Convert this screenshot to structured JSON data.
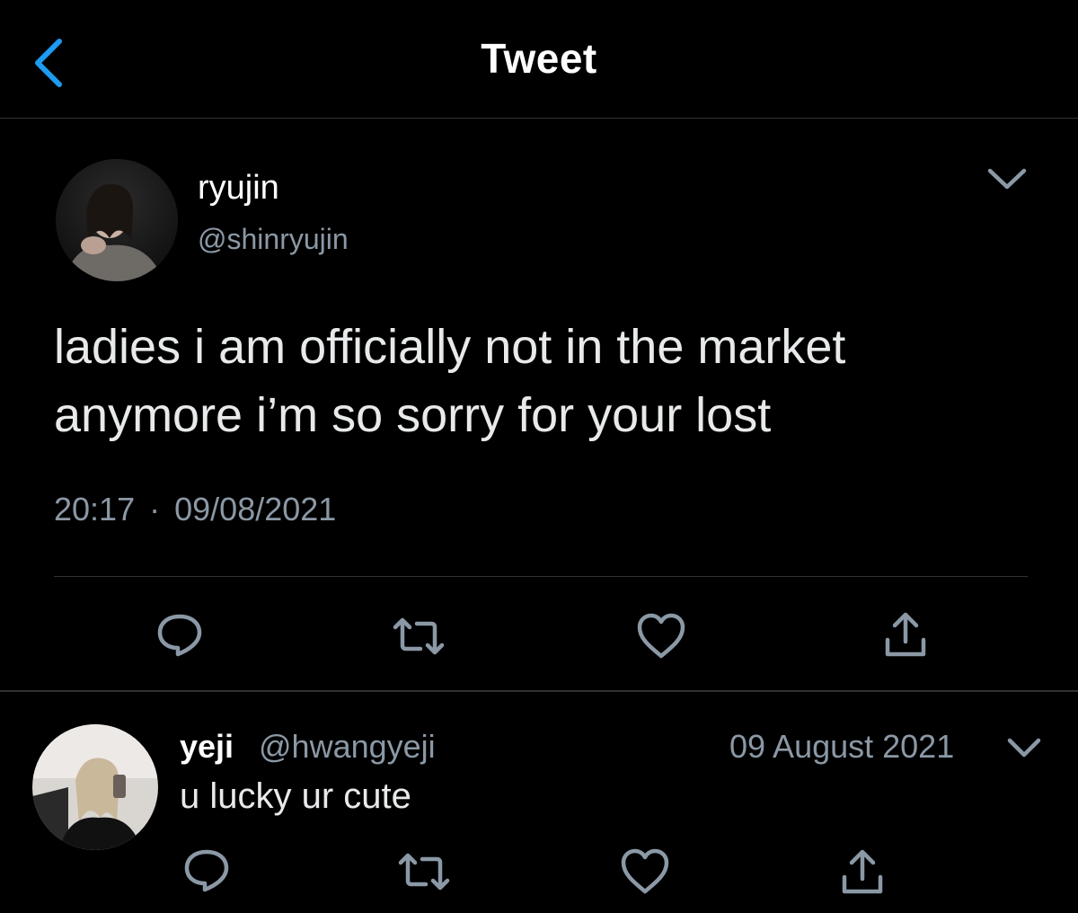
{
  "header": {
    "title": "Tweet",
    "back_icon": "chevron-left-icon"
  },
  "tweet": {
    "display_name": "ryujin",
    "handle": "@shinryujin",
    "text_line1": "ladies i am officially not in the market",
    "text_line2": "anymore i’m so sorry for your lost",
    "time": "20:17",
    "date": "09/08/2021",
    "separator": "·",
    "actions": [
      "reply-icon",
      "retweet-icon",
      "like-icon",
      "share-icon"
    ]
  },
  "reply": {
    "display_name": "yeji",
    "handle": "@hwangyeji",
    "date": "09 August 2021",
    "text": "u lucky ur cute"
  },
  "colors": {
    "background": "#000000",
    "text": "#e7e9ea",
    "secondary": "#8b98a5",
    "accent": "#1d9bf0",
    "divider": "#2f3336"
  }
}
